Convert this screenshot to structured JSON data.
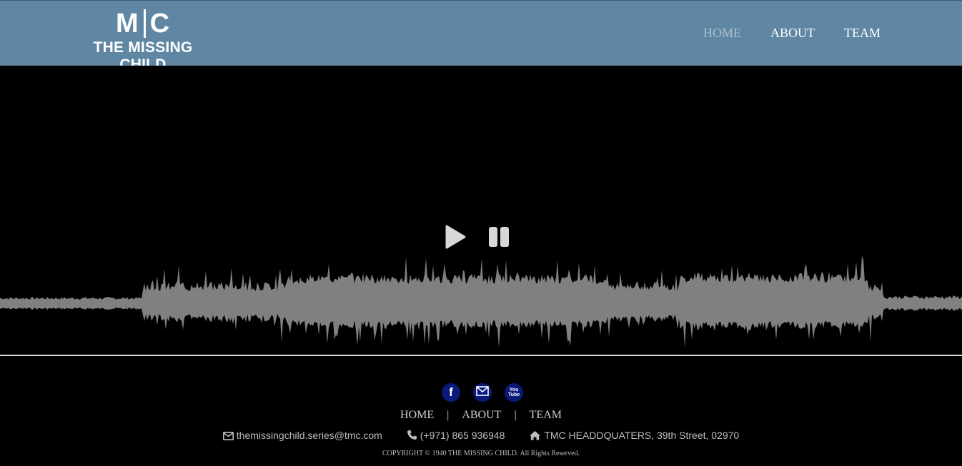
{
  "header": {
    "logo_mark_left": "M",
    "logo_mark_right": "C",
    "logo_name": "THE MISSING CHILD",
    "nav": [
      {
        "label": "HOME",
        "active": true
      },
      {
        "label": "ABOUT",
        "active": false
      },
      {
        "label": "TEAM",
        "active": false
      }
    ],
    "bg_color": "#5f87a3"
  },
  "player": {
    "play_icon": "play-icon",
    "pause_icon": "pause-icon",
    "waveform_color": "#808080"
  },
  "footer": {
    "social": [
      {
        "name": "facebook-icon",
        "glyph": "f"
      },
      {
        "name": "email-icon",
        "glyph": "✉"
      },
      {
        "name": "youtube-icon",
        "glyph": "You Tube"
      }
    ],
    "nav": [
      "HOME",
      "ABOUT",
      "TEAM"
    ],
    "separator": "|",
    "email": "themissingchild.series@tmc.com",
    "phone": "(+971) 865 936948",
    "address": "TMC HEADDQUATERS, 39th Street, 02970",
    "copyright": "COPYRIGHT © 1940 THE MISSING CHILD. All Rights Reserved."
  }
}
